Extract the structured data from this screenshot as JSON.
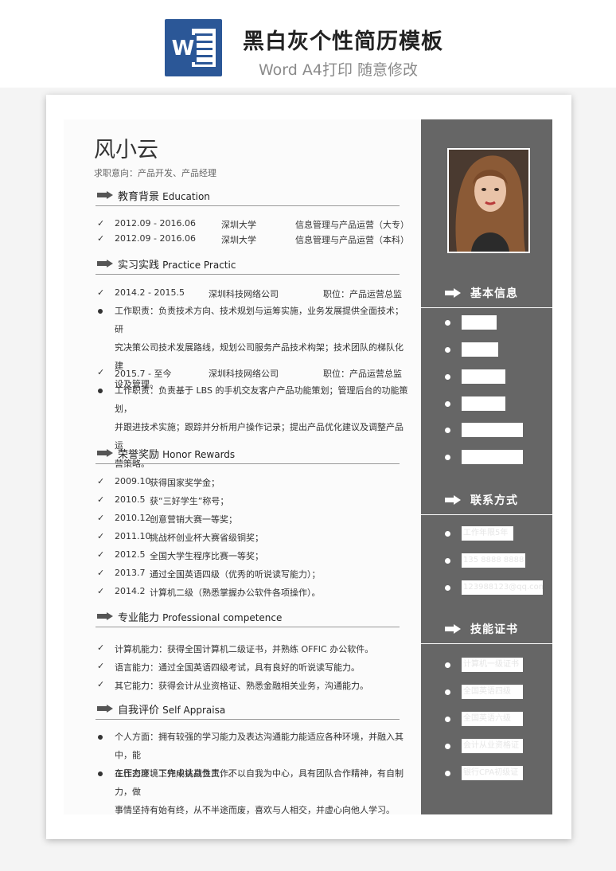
{
  "banner": {
    "title": "黑白灰个性简历模板",
    "subtitle": "Word A4打印 随意修改",
    "icon": "word-icon",
    "icon_letter": "W"
  },
  "resume": {
    "name": "风小云",
    "intent": "求职意向：产品开发、产品经理",
    "education": {
      "title_cn": "教育背景",
      "title_en": "Education",
      "rows": [
        {
          "period": "2012.09 - 2016.06",
          "school": "深圳大学",
          "major": "信息管理与产品运营（大专）"
        },
        {
          "period": "2012.09 - 2016.06",
          "school": "深圳大学",
          "major": "信息管理与产品运营（本科）"
        }
      ]
    },
    "practice": {
      "title_cn": "实习实践",
      "title_en": "Practice Practic",
      "jobs": [
        {
          "period": "2014.2 - 2015.5",
          "company": "深圳科技网络公司",
          "position": "职位：产品运营总监",
          "lines": [
            "工作职责：负责技术方向、技术规划与运筹实施，业务发展提供全面技术；研",
            "究决策公司技术发展路线，规划公司服务产品技术构架；技术团队的梯队化建",
            "设及管理。"
          ]
        },
        {
          "period": "2015.7 -  至今",
          "company": "深圳科技网络公司",
          "position": "职位：产品运营总监",
          "lines": [
            "工作职责：负责基于 LBS 的手机交友客户产品功能策划；管理后台的功能策划，",
            "并跟进技术实施；跟踪并分析用户操作记录；提出产品优化建议及调整产品运",
            "营策略。"
          ]
        }
      ]
    },
    "honors": {
      "title_cn": "荣誉奖励",
      "title_en": "Honor Rewards",
      "items": [
        {
          "date": "2009.10",
          "text": "获得国家奖学金；"
        },
        {
          "date": "2010.5",
          "text": "获“三好学生”称号；"
        },
        {
          "date": "2010.12",
          "text": "创意营销大赛一等奖；"
        },
        {
          "date": "2011.10",
          "text": "挑战杯创业杯大赛省级铜奖；"
        },
        {
          "date": "2012.5",
          "text": "全国大学生程序比赛一等奖；"
        },
        {
          "date": "2013.7",
          "text": "通过全国英语四级（优秀的听说读写能力）；"
        },
        {
          "date": "2014.2",
          "text": "计算机二级（熟悉掌握办公软件各项操作）。"
        }
      ]
    },
    "skills": {
      "title_cn": "专业能力",
      "title_en": "Professional competence",
      "items": [
        "计算机能力：获得全国计算机二级证书，并熟练 OFFIC 办公软件。",
        "语言能力：通过全国英语四级考试，具有良好的听说读写能力。",
        "其它能力：获得会计从业资格证、熟悉金融相关业务，沟通能力。"
      ]
    },
    "self": {
      "title_cn": "自我评价",
      "title_en": "Self Appraisa",
      "items": [
        {
          "lines": [
            "个人方面：拥有较强的学习能力及表达沟通能力能适应各种环境，并融入其中，能",
            "在压力环境下完成挑战性工作。"
          ]
        },
        {
          "lines": [
            "工作态度：工作中认真负责，不以自我为中心，具有团队合作精神，有自制力，做",
            "事情坚持有始有终，从不半途而废，喜欢与人相交，并虚心向他人学习。"
          ]
        }
      ]
    }
  },
  "sidebar": {
    "photo": "portrait-photo",
    "basic": {
      "title": "基本信息"
    },
    "contact": {
      "title": "联系方式",
      "items": [
        "工作年限5年",
        "135 8888 8888",
        "123988123@qq.com"
      ]
    },
    "certs": {
      "title": "技能证书",
      "items": [
        "计算机一级证书",
        "全国英语四级",
        "全国英语六级",
        "会计从业资格证",
        "银行CPA初级证"
      ]
    }
  },
  "colors": {
    "sidebar": "#666666",
    "text": "#333333",
    "rule": "#999999"
  }
}
